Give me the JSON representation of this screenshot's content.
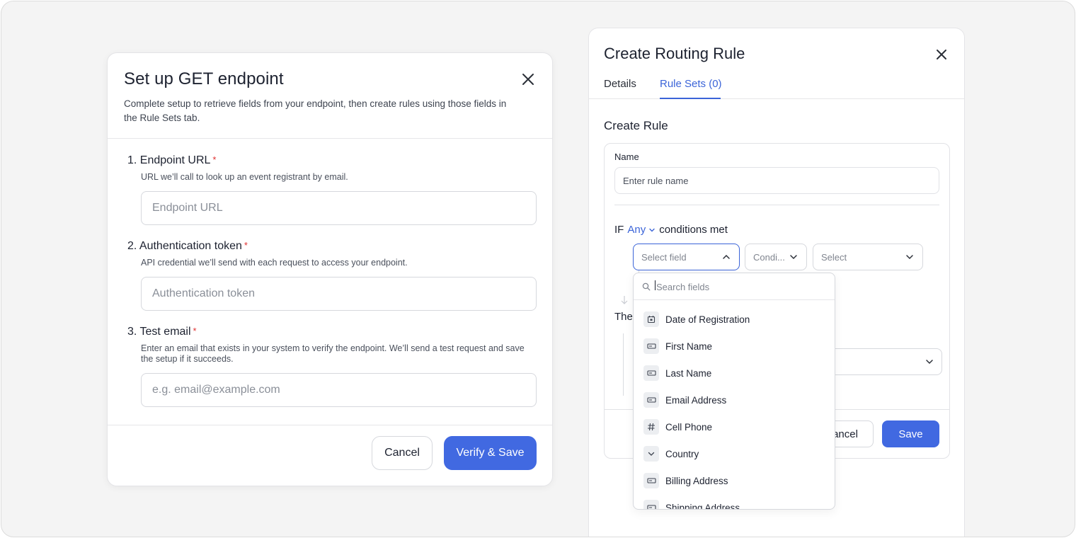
{
  "left_modal": {
    "title": "Set up GET endpoint",
    "description": "Complete setup to retrieve fields from your endpoint, then create rules using those fields in the Rule Sets tab.",
    "fields": [
      {
        "label": "1. Endpoint URL",
        "required_mark": "*",
        "help": "URL we’ll call to look up an event registrant by email.",
        "placeholder": "Endpoint URL"
      },
      {
        "label": "2. Authentication token",
        "required_mark": "*",
        "help": "API credential we’ll send with each request to access your endpoint.",
        "placeholder": "Authentication token"
      },
      {
        "label": "3. Test email",
        "required_mark": "*",
        "help": "Enter an email that exists in your system to verify the endpoint. We’ll send a test request and save the setup if it succeeds.",
        "placeholder": "e.g. email@example.com"
      }
    ],
    "cancel_label": "Cancel",
    "primary_label": "Verify & Save"
  },
  "right_panel": {
    "title": "Create Routing Rule",
    "tabs": [
      {
        "label": "Details",
        "active": false
      },
      {
        "label": "Rule Sets (0)",
        "active": true
      }
    ],
    "section_title": "Create Rule",
    "name_label": "Name",
    "name_placeholder": "Enter rule name",
    "if_prefix": "IF",
    "if_match": "Any",
    "if_suffix": "conditions met",
    "condition": {
      "field_placeholder": "Select field",
      "operator_placeholder": "Condi...",
      "value_placeholder": "Select"
    },
    "then_label": "The",
    "cancel_label": "ancel",
    "save_label": "Save"
  },
  "dropdown": {
    "search_placeholder": "Search fields",
    "items": [
      {
        "label": "Date of Registration",
        "icon": "calendar-icon"
      },
      {
        "label": "First Name",
        "icon": "text-field-icon"
      },
      {
        "label": "Last Name",
        "icon": "text-field-icon"
      },
      {
        "label": "Email Address",
        "icon": "text-field-icon"
      },
      {
        "label": "Cell Phone",
        "icon": "hash-icon"
      },
      {
        "label": "Country",
        "icon": "chevron-down-icon"
      },
      {
        "label": "Billing Address",
        "icon": "text-field-icon"
      },
      {
        "label": "Shipping Address",
        "icon": "text-field-icon"
      }
    ]
  },
  "colors": {
    "accent": "#4169e1",
    "link": "#3b64d8",
    "required": "#e03131",
    "background": "#f4f4f4"
  }
}
